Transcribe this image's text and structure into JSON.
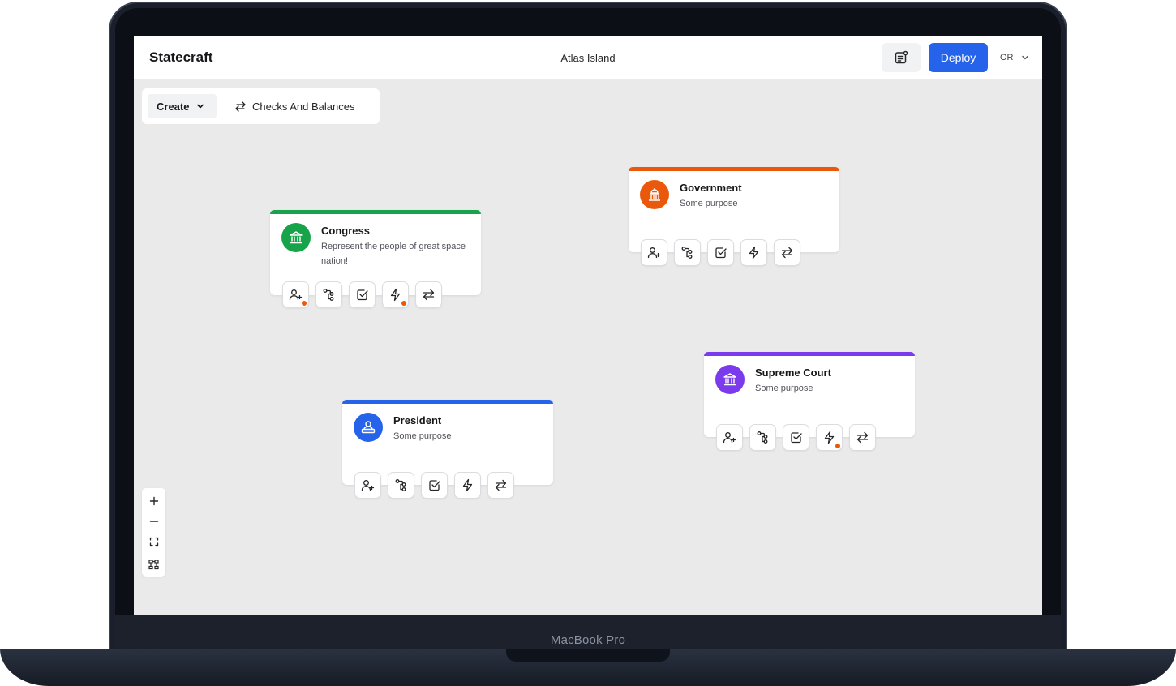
{
  "device": {
    "brand_label": "MacBook Pro"
  },
  "header": {
    "app_title": "Statecraft",
    "project_name": "Atlas Island",
    "deploy_label": "Deploy",
    "avatar_initials": "OR"
  },
  "toolbar": {
    "create_label": "Create",
    "checks_label": "Checks And Balances"
  },
  "cards": {
    "congress": {
      "title": "Congress",
      "description": "Represent the people of great space nation!",
      "color": "#16a34a"
    },
    "government": {
      "title": "Government",
      "description": "Some purpose",
      "color": "#ea580c"
    },
    "president": {
      "title": "President",
      "description": "Some purpose",
      "color": "#2563eb"
    },
    "supreme_court": {
      "title": "Supreme Court",
      "description": "Some purpose",
      "color": "#7c3aed"
    }
  },
  "colors": {
    "accent": "#2563eb",
    "canvas": "#eaeaea",
    "notification_dot": "#ea580c"
  }
}
